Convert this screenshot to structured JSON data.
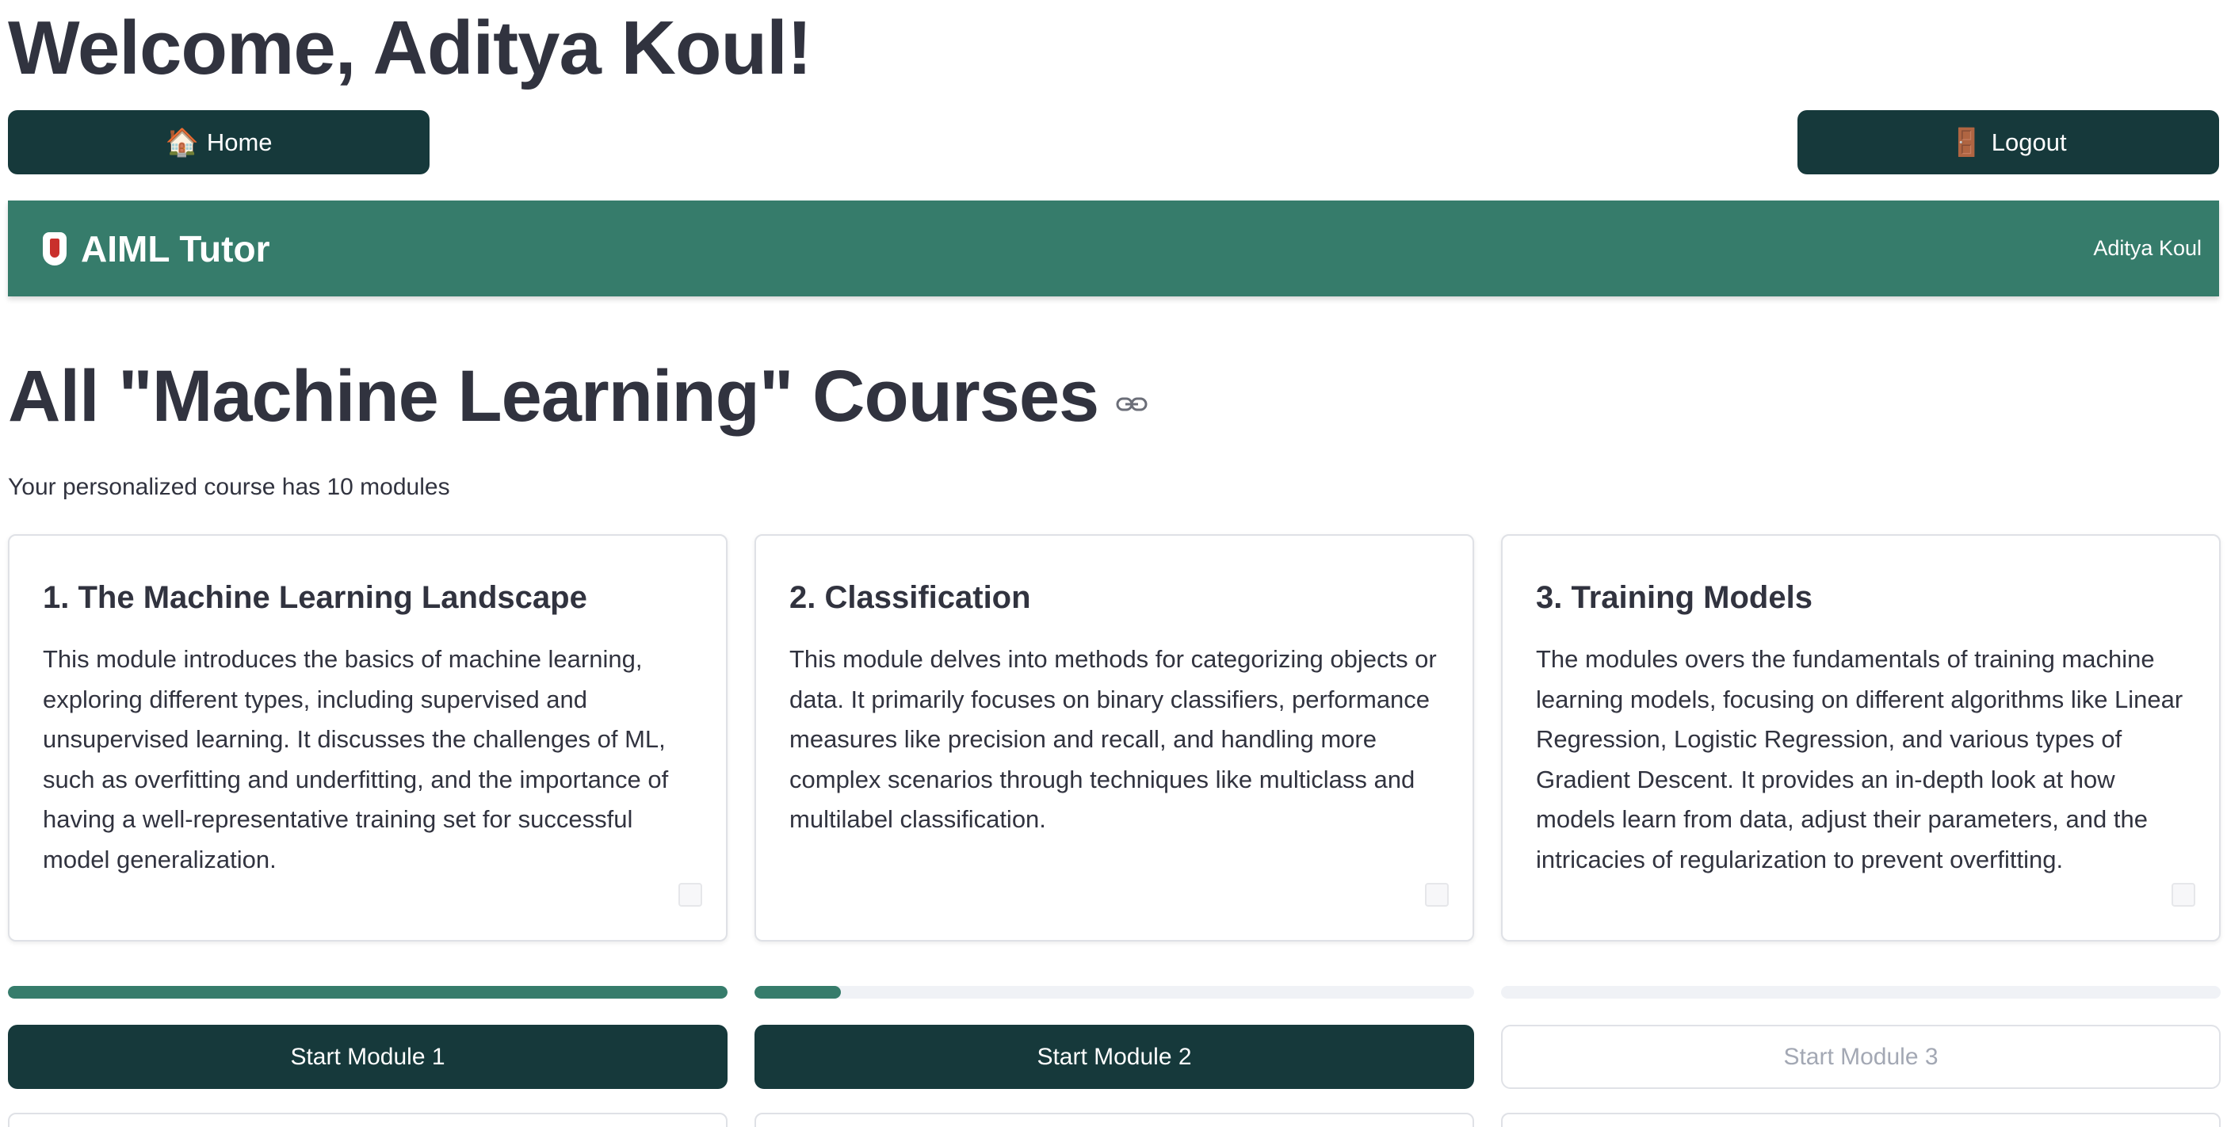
{
  "header": {
    "welcome": "Welcome, Aditya Koul!"
  },
  "nav": {
    "home_icon": "🏠",
    "home_label": "Home",
    "logout_icon": "🚪",
    "logout_label": "Logout"
  },
  "banner": {
    "brand": "AIML Tutor",
    "user": "Aditya Koul",
    "colors": {
      "background": "#367c6b"
    }
  },
  "main": {
    "title": "All \"Machine Learning\" Courses",
    "subtitle": "Your personalized course has 10 modules"
  },
  "modules": [
    {
      "title": "1. The Machine Learning Landscape",
      "description": "This module introduces the basics of machine learning, exploring different types, including supervised and unsupervised learning. It discusses the challenges of ML, such as overfitting and underfitting, and the importance of having a well-representative training set for successful model generalization.",
      "progress": 1.0,
      "button": "Start Module 1",
      "enabled": true
    },
    {
      "title": "2. Classification",
      "description": "This module delves into methods for categorizing objects or data. It primarily focuses on binary classifiers, performance measures like precision and recall, and handling more complex scenarios through techniques like multiclass and multilabel classification.",
      "progress": 0.12,
      "button": "Start Module 2",
      "enabled": true
    },
    {
      "title": "3. Training Models",
      "description": "The modules overs the fundamentals of training machine learning models, focusing on different algorithms like Linear Regression, Logistic Regression, and various types of Gradient Descent. It provides an in-depth look at how models learn from data, adjust their parameters, and the intricacies of regularization to prevent overfitting.",
      "progress": 0.0,
      "button": "Start Module 3",
      "enabled": false
    }
  ],
  "colors": {
    "primary_button": "#16393b",
    "progress_fill": "#367c6b",
    "progress_track": "#f0f2f6",
    "text": "#31333f"
  }
}
